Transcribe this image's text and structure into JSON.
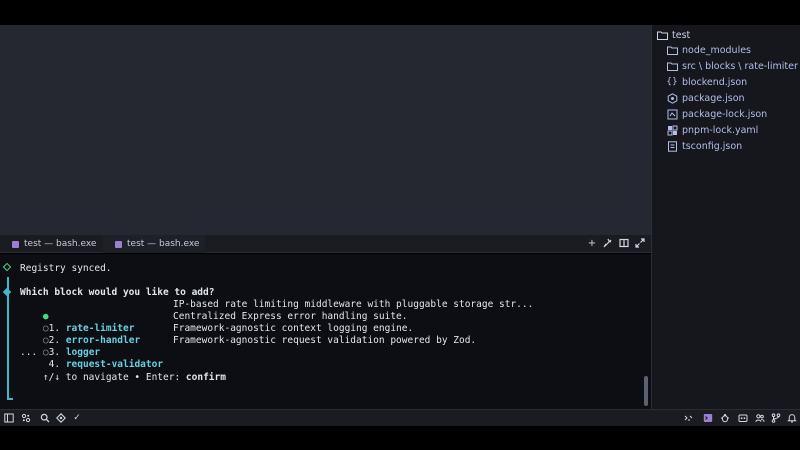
{
  "explorer": {
    "root": "test",
    "items": [
      {
        "label": "node_modules",
        "icon": "folder-icon"
      },
      {
        "label": "src \\ blocks \\ rate-limiter",
        "icon": "folder-icon"
      },
      {
        "label": "blockend.json",
        "icon": "json-braces-icon"
      },
      {
        "label": "package.json",
        "icon": "package-icon"
      },
      {
        "label": "package-lock.json",
        "icon": "package-lock-icon"
      },
      {
        "label": "pnpm-lock.yaml",
        "icon": "pnpm-icon"
      },
      {
        "label": "tsconfig.json",
        "icon": "tsconfig-icon"
      }
    ]
  },
  "terminal_tabs": [
    {
      "label": "test — bash.exe",
      "active": false
    },
    {
      "label": "test — bash.exe",
      "active": true
    }
  ],
  "terminal": {
    "synced": "Registry synced.",
    "prompt": "Which block would you like to add?",
    "options": [
      {
        "num": "1.",
        "name": "rate-limiter",
        "desc": "IP-based rate limiting middleware with pluggable storage str...",
        "selected": true
      },
      {
        "num": "2.",
        "name": "error-handler",
        "desc": "Centralized Express error handling suite.",
        "selected": false
      },
      {
        "num": "3.",
        "name": "logger",
        "desc": "Framework-agnostic context logging engine.",
        "selected": false
      },
      {
        "num": "4.",
        "name": "request-validator",
        "desc": "Framework-agnostic request validation powered by Zod.",
        "selected": false
      }
    ],
    "ellipsis": "...",
    "hint_keys": "↑/↓",
    "hint_nav": " to navigate • Enter: ",
    "hint_confirm": "confirm"
  },
  "colors": {
    "accent": "#3fb8c8",
    "selected_dot": "#3ddc84",
    "success_diamond": "#3ddc84"
  }
}
